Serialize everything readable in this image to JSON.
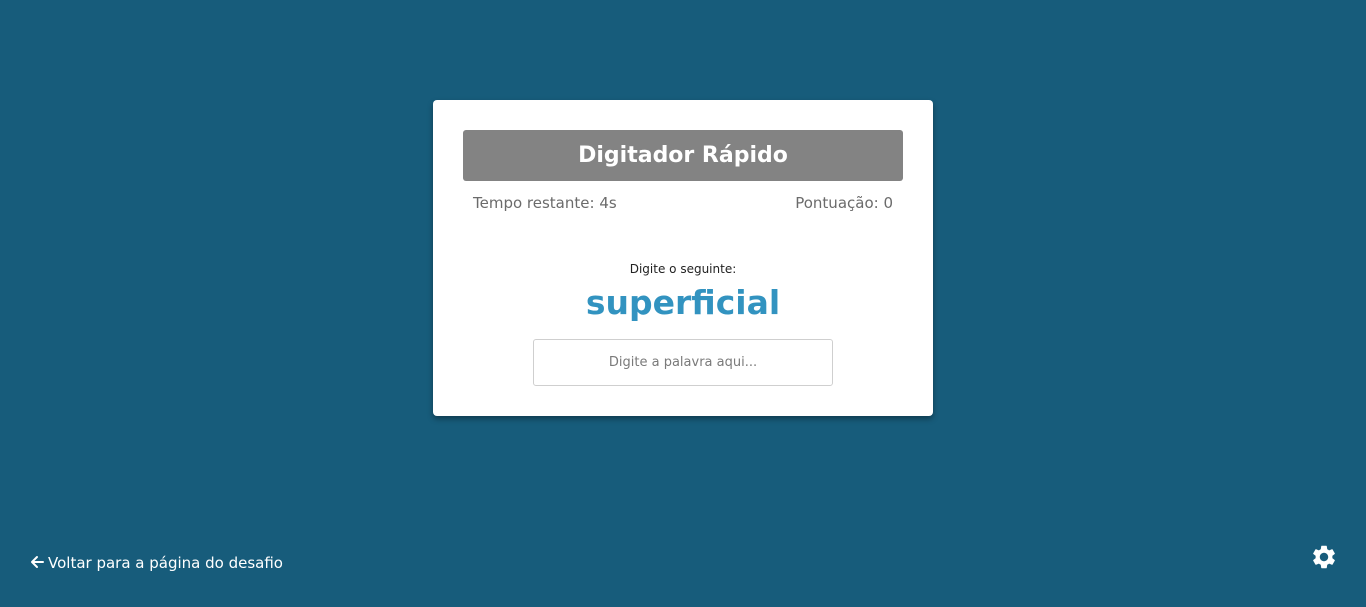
{
  "game": {
    "title": "Digitador Rápido",
    "time_left": "Tempo restante: 4s",
    "score": "Pontuação: 0",
    "prompt_label": "Digite o seguinte:",
    "word": "superficial",
    "input_placeholder": "Digite a palavra aqui...",
    "input_value": ""
  },
  "footer": {
    "back_label": "Voltar para a página do desafio",
    "back_icon": "arrow-left-icon",
    "settings_icon": "gear-icon"
  },
  "colors": {
    "background": "#175c7b",
    "title_bar": "#838383",
    "word": "#3293c0"
  }
}
